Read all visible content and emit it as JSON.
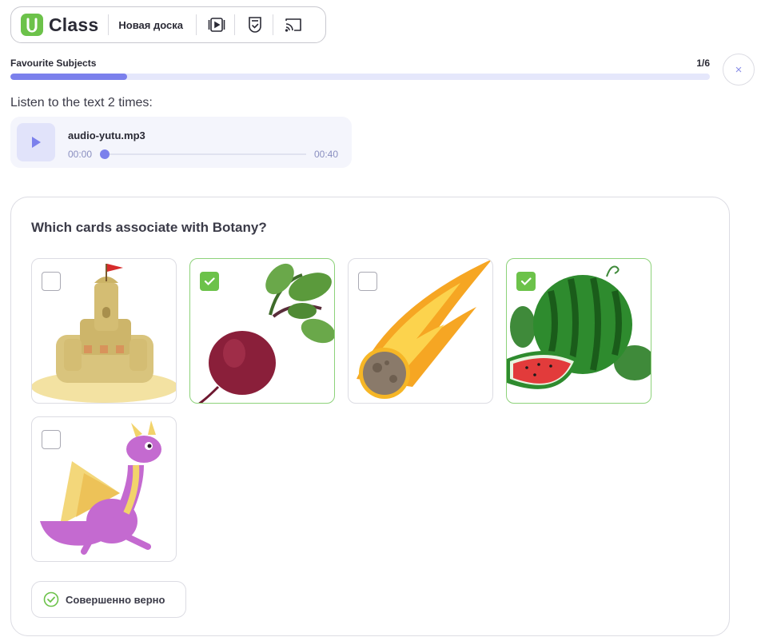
{
  "header": {
    "logo_text": "Class",
    "board_label": "Новая доска",
    "tools": [
      {
        "icon": "video-player-icon"
      },
      {
        "icon": "shield-check-icon"
      },
      {
        "icon": "cast-icon"
      }
    ]
  },
  "lesson": {
    "title": "Favourite Subjects",
    "counter": "1/6",
    "progress": 0.167,
    "close_label": "×"
  },
  "audio": {
    "instruction": "Listen to the text 2 times:",
    "file_name": "audio-yutu.mp3",
    "current_time": "00:00",
    "duration": "00:40",
    "position": 0
  },
  "question": {
    "text": "Which cards associate with Botany?",
    "cards": [
      {
        "name": "sand-castle",
        "checked": false
      },
      {
        "name": "beetroot",
        "checked": true
      },
      {
        "name": "meteor",
        "checked": false
      },
      {
        "name": "watermelon",
        "checked": true
      },
      {
        "name": "dragon",
        "checked": false
      }
    ],
    "result_text": "Совершенно верно"
  },
  "colors": {
    "accent": "#7b80ec",
    "success": "#6cc24a",
    "card_border_selected": "#8dd27a"
  }
}
